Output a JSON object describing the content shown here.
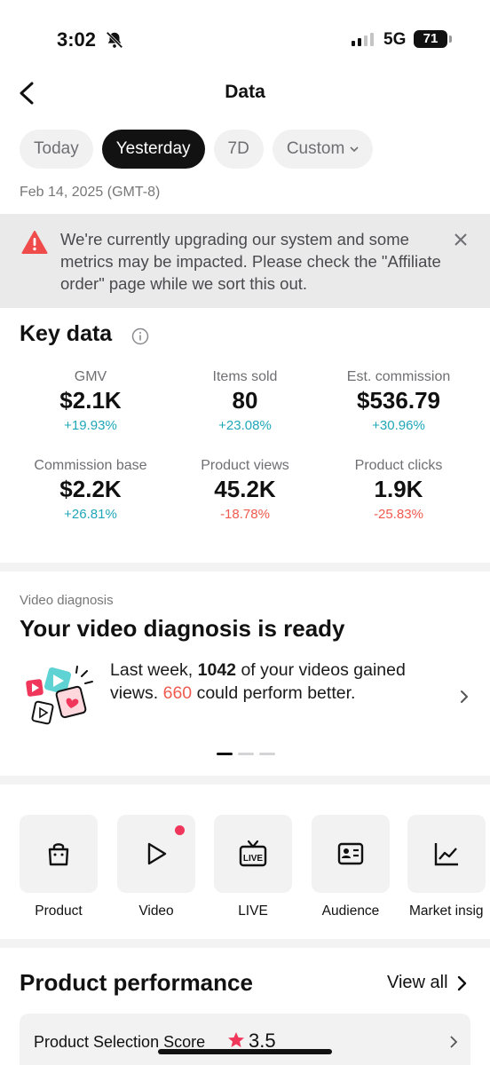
{
  "status": {
    "time": "3:02",
    "network": "5G",
    "battery": "71"
  },
  "header": {
    "title": "Data"
  },
  "tabs": [
    {
      "label": "Today"
    },
    {
      "label": "Yesterday",
      "active": true
    },
    {
      "label": "7D"
    },
    {
      "label": "Custom"
    }
  ],
  "date": "Feb 14, 2025 (GMT-8)",
  "banner": {
    "text": "We're currently upgrading our system and some metrics may be impacted. Please check the \"Affiliate order\" page while we sort this out."
  },
  "key_data": {
    "title": "Key data",
    "metrics": [
      {
        "label": "GMV",
        "value": "$2.1K",
        "delta": "+19.93%",
        "trend": "up"
      },
      {
        "label": "Items sold",
        "value": "80",
        "delta": "+23.08%",
        "trend": "up"
      },
      {
        "label": "Est. commission",
        "value": "$536.79",
        "delta": "+30.96%",
        "trend": "up"
      },
      {
        "label": "Commission base",
        "value": "$2.2K",
        "delta": "+26.81%",
        "trend": "up"
      },
      {
        "label": "Product views",
        "value": "45.2K",
        "delta": "-18.78%",
        "trend": "down"
      },
      {
        "label": "Product clicks",
        "value": "1.9K",
        "delta": "-25.83%",
        "trend": "down"
      }
    ]
  },
  "video_diagnosis": {
    "label": "Video diagnosis",
    "title": "Your video diagnosis is ready",
    "text_1": "Last week, ",
    "count_gained": "1042",
    "text_2": " of your videos gained views. ",
    "count_better": "660",
    "text_3": " could perform better."
  },
  "tools": [
    {
      "label": "Product",
      "icon": "shopping-bag-icon"
    },
    {
      "label": "Video",
      "icon": "play-icon"
    },
    {
      "label": "LIVE",
      "icon": "live-tv-icon"
    },
    {
      "label": "Audience",
      "icon": "id-card-icon"
    },
    {
      "label": "Market insig",
      "icon": "trend-chart-icon"
    }
  ],
  "product_performance": {
    "title": "Product performance",
    "view_all": "View all",
    "score_label": "Product Selection Score",
    "score_value": "3.5"
  },
  "colors": {
    "up": "#1fa7b8",
    "down": "#f05a4f",
    "accent": "#f0365a"
  }
}
